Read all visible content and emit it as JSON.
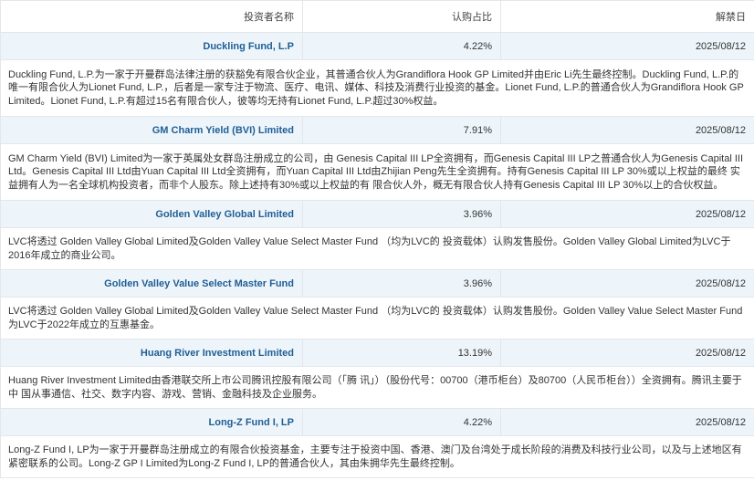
{
  "table": {
    "headers": {
      "name": "投资者名称",
      "pct": "认购占比",
      "date": "解禁日"
    },
    "rows": [
      {
        "name": "Duckling Fund, L.P",
        "pct": "4.22%",
        "date": "2025/08/12",
        "desc": "Duckling Fund, L.P.为一家于开曼群岛法律注册的获豁免有限合伙企业，其普通合伙人为Grandiflora Hook GP Limited并由Eric Li先生最终控制。Duckling Fund, L.P.的唯一有限合伙人为Lionet Fund, L.P.，后者是一家专注于物流、医疗、电讯、媒体、科技及消费行业投资的基金。Lionet Fund, L.P.的普通合伙人为Grandiflora Hook GP Limited。Lionet Fund, L.P.有超过15名有限合伙人，彼等均无持有Lionet Fund, L.P.超过30%权益。"
      },
      {
        "name": "GM Charm Yield (BVI) Limited",
        "pct": "7.91%",
        "date": "2025/08/12",
        "desc": "GM Charm Yield (BVI) Limited为一家于英属处女群岛注册成立的公司，由 Genesis Capital III LP全资拥有，而Genesis Capital III LP之普通合伙人为Genesis Capital III Ltd。Genesis Capital III Ltd由Yuan Capital III Ltd全资拥有，而Yuan Capital III Ltd由Zhijian Peng先生全资拥有。持有Genesis Capital III LP 30%或以上权益的最终 实益拥有人为一名全球机构投资者，而非个人股东。除上述持有30%或以上权益的有 限合伙人外，概无有限合伙人持有Genesis Capital III LP 30%以上的合伙权益。"
      },
      {
        "name": "Golden Valley Global Limited",
        "pct": "3.96%",
        "date": "2025/08/12",
        "desc": "LVC将透过 Golden Valley Global Limited及Golden Valley Value Select Master Fund （均为LVC的 投资载体）认购发售股份。Golden Valley Global Limited为LVC于2016年成立的商业公司。"
      },
      {
        "name": "Golden Valley Value Select Master Fund",
        "pct": "3.96%",
        "date": "2025/08/12",
        "desc": "LVC将透过 Golden Valley Global Limited及Golden Valley Value Select Master Fund （均为LVC的 投资载体）认购发售股份。Golden Valley Value Select Master Fund为LVC于2022年成立的互惠基金。"
      },
      {
        "name": "Huang River Investment Limited",
        "pct": "13.19%",
        "date": "2025/08/12",
        "desc": "Huang River Investment Limited由香港联交所上市公司腾讯控股有限公司（「腾 讯」）（股份代号：00700（港币柜台）及80700（人民币柜台））全资拥有。腾讯主要于中 国从事通信、社交、数字内容、游戏、营销、金融科技及企业服务。"
      },
      {
        "name": "Long-Z Fund I, LP",
        "pct": "4.22%",
        "date": "2025/08/12",
        "desc": "Long-Z Fund I, LP为一家于开曼群岛注册成立的有限合伙投资基金，主要专注于投资中国、香港、澳门及台湾处于成长阶段的消费及科技行业公司，以及与上述地区有紧密联系的公司。Long-Z GP I Limited为Long-Z Fund I, LP的普通合伙人，其由朱拥华先生最终控制。"
      }
    ]
  }
}
